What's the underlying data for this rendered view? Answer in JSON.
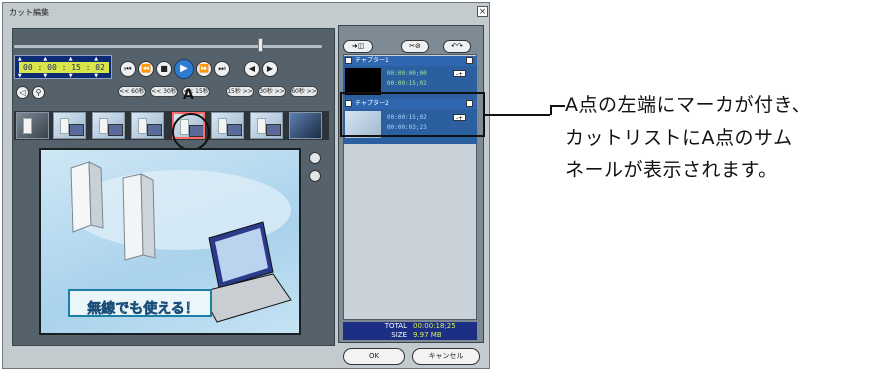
{
  "window": {
    "title": "カット編集",
    "close_glyph": "×"
  },
  "player": {
    "timecode": "00 : 00 : 15 : 02",
    "timecode_arrows_up": "▲ ▲ ▲ ▲",
    "timecode_arrows_down": "▼ ▼ ▼ ▼",
    "transport": {
      "rewind_start": "⏮",
      "rewind": "⏪",
      "stop": "■",
      "play": "▶",
      "forward": "⏩",
      "forward_end": "⏭",
      "prev_frame": "◀",
      "next_frame": "▶"
    },
    "jump_buttons": [
      "<< 60秒",
      "<< 30秒",
      "<< 15秒",
      "15秒 >>",
      "30秒 >>",
      "60秒 >>"
    ],
    "thumbnail_label": "A",
    "preview_caption": "無線でも使える！"
  },
  "cut_list": {
    "chapters": [
      {
        "name": "チャプター1",
        "in": "00:00:00;00",
        "out": "00:00:15;02"
      },
      {
        "name": "チャプター2",
        "in": "00:00:15;02",
        "out": "00:00:03;23"
      }
    ],
    "total_label": "TOTAL",
    "total_value": "00:00:18;25",
    "size_label": "SIZE",
    "size_value": "9.97 MB"
  },
  "buttons": {
    "ok": "OK",
    "cancel": "キャンセル"
  },
  "annotation": {
    "lines": [
      "A点の左端にマーカが付き、",
      "カットリストにA点のサム",
      "ネールが表示されます。"
    ]
  },
  "colors": {
    "panel": "#56626b",
    "timecode_bg": "#0d2a75",
    "timecode_fg": "#d8e64a",
    "chapter_bg": "#2b5f9f",
    "selection": "#ff6a6a"
  }
}
